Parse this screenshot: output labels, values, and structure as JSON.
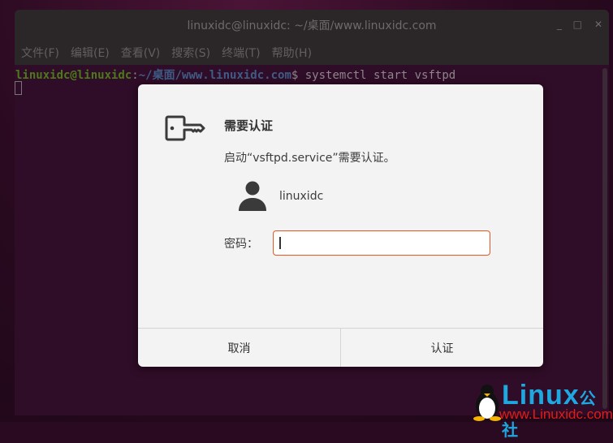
{
  "terminal": {
    "title": "linuxidc@linuxidc: ~/桌面/www.linuxidc.com",
    "menu": [
      "文件(F)",
      "编辑(E)",
      "查看(V)",
      "搜索(S)",
      "终端(T)",
      "帮助(H)"
    ],
    "prompt_user": "linuxidc@linuxidc",
    "prompt_sep": ":",
    "prompt_path": "~/桌面/www.linuxidc.com",
    "prompt_symbol": "$",
    "command": " systemctl start vsftpd"
  },
  "dialog": {
    "title": "需要认证",
    "message": "启动“vsftpd.service”需要认证。",
    "username": "linuxidc",
    "password_label": "密码：",
    "password_value": "",
    "cancel": "取消",
    "authenticate": "认证"
  },
  "watermark": {
    "brand": "Linux",
    "brand_cn": "公社",
    "url": "www.Linuxidc.com"
  },
  "colors": {
    "accent": "#e95420"
  }
}
